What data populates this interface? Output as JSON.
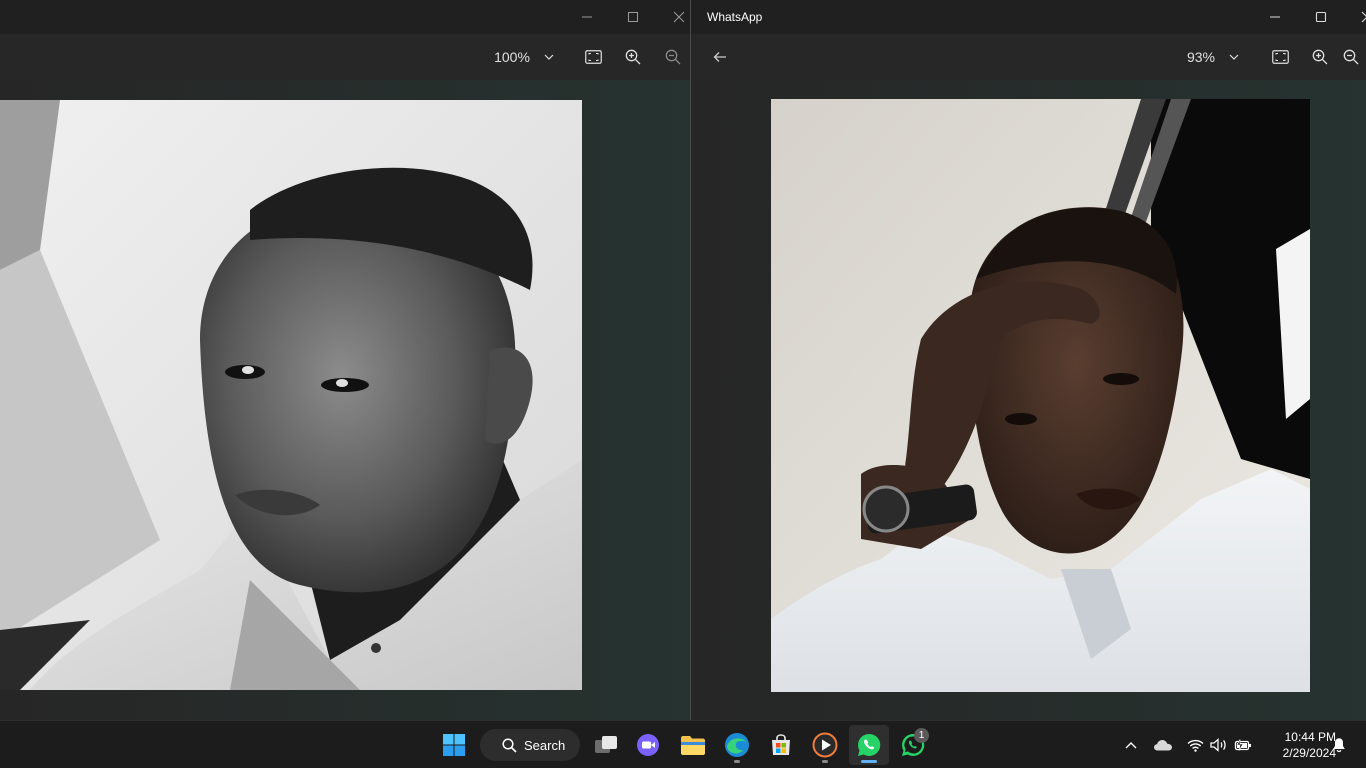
{
  "left_window": {
    "zoom_label": "100%",
    "icons": [
      "minimize-icon",
      "maximize-icon",
      "close-icon",
      "fit-to-window-icon",
      "zoom-in-icon",
      "zoom-out-icon",
      "chevron-down-icon"
    ]
  },
  "right_window": {
    "title": "WhatsApp",
    "zoom_label": "93%",
    "icons": [
      "back-arrow-icon",
      "minimize-icon",
      "maximize-icon",
      "close-icon",
      "fit-to-window-icon",
      "zoom-in-icon",
      "zoom-out-icon",
      "chevron-down-icon"
    ]
  },
  "taskbar": {
    "search_label": "Search",
    "apps": [
      "start-button",
      "search",
      "task-view",
      "meet-video",
      "file-explorer",
      "edge-browser",
      "microsoft-store",
      "media-player",
      "whatsapp",
      "whatsapp-beta"
    ],
    "whatsapp_beta_badge": "1",
    "clock": {
      "time": "10:44 PM",
      "date": "2/29/2024"
    }
  },
  "colors": {
    "titlebar": "#202020",
    "toolbar": "#272727",
    "taskbar": "#1c1c1c",
    "accent": "#62b0f2",
    "whatsapp_green": "#25d366"
  }
}
